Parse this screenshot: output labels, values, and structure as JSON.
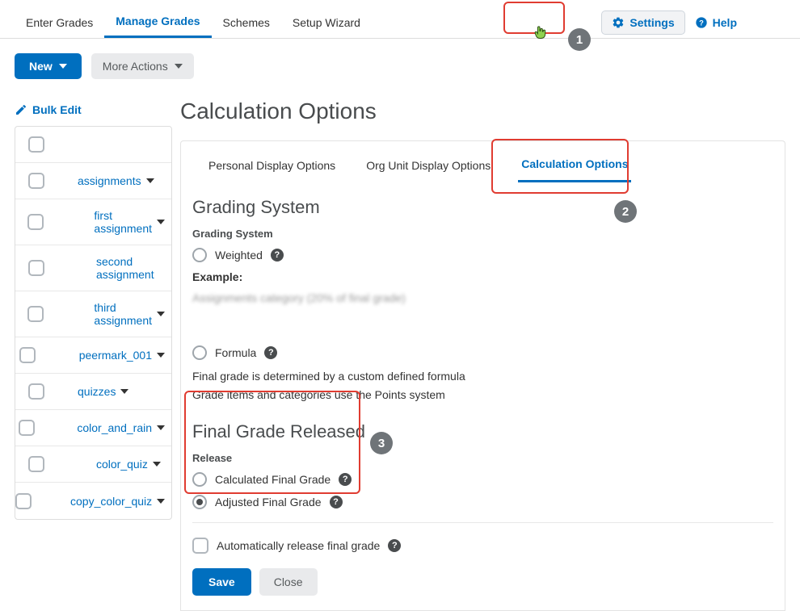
{
  "topNav": {
    "tabs": [
      {
        "label": "Enter Grades",
        "active": false
      },
      {
        "label": "Manage Grades",
        "active": true
      },
      {
        "label": "Schemes",
        "active": false
      },
      {
        "label": "Setup Wizard",
        "active": false
      }
    ],
    "settings": "Settings",
    "help": "Help"
  },
  "actions": {
    "new": "New",
    "more": "More Actions",
    "bulkEdit": "Bulk Edit"
  },
  "sidebarItems": [
    {
      "label": "",
      "indent": 0,
      "chev": false,
      "blank": true
    },
    {
      "label": "assignments",
      "indent": 1,
      "chev": true
    },
    {
      "label": "first assignment",
      "indent": 2,
      "chev": true
    },
    {
      "label": "second assignment",
      "indent": 2,
      "chev": false
    },
    {
      "label": "third assignment",
      "indent": 2,
      "chev": true
    },
    {
      "label": "peermark_001",
      "indent": 2,
      "chev": true
    },
    {
      "label": "quizzes",
      "indent": 1,
      "chev": true
    },
    {
      "label": "color_and_rain",
      "indent": 2,
      "chev": true
    },
    {
      "label": "color_quiz",
      "indent": 2,
      "chev": true
    },
    {
      "label": "copy_color_quiz",
      "indent": 2,
      "chev": true
    }
  ],
  "panel": {
    "title": "Calculation Options",
    "subTabs": [
      {
        "label": "Personal Display Options",
        "active": false
      },
      {
        "label": "Org Unit Display Options",
        "active": false
      },
      {
        "label": "Calculation Options",
        "active": true
      }
    ],
    "gradingSystem": {
      "heading": "Grading System",
      "sub": "Grading System",
      "weighted": "Weighted",
      "example": "Example:",
      "formula": "Formula",
      "formulaDesc1": "Final grade is determined by a custom defined formula",
      "formulaDesc2": "Grade items and categories use the Points system"
    },
    "finalGrade": {
      "heading": "Final Grade Released",
      "sub": "Release",
      "calculated": "Calculated Final Grade",
      "adjusted": "Adjusted Final Grade",
      "auto": "Automatically release final grade"
    },
    "buttons": {
      "save": "Save",
      "close": "Close"
    }
  },
  "badges": {
    "b1": "1",
    "b2": "2",
    "b3": "3"
  }
}
